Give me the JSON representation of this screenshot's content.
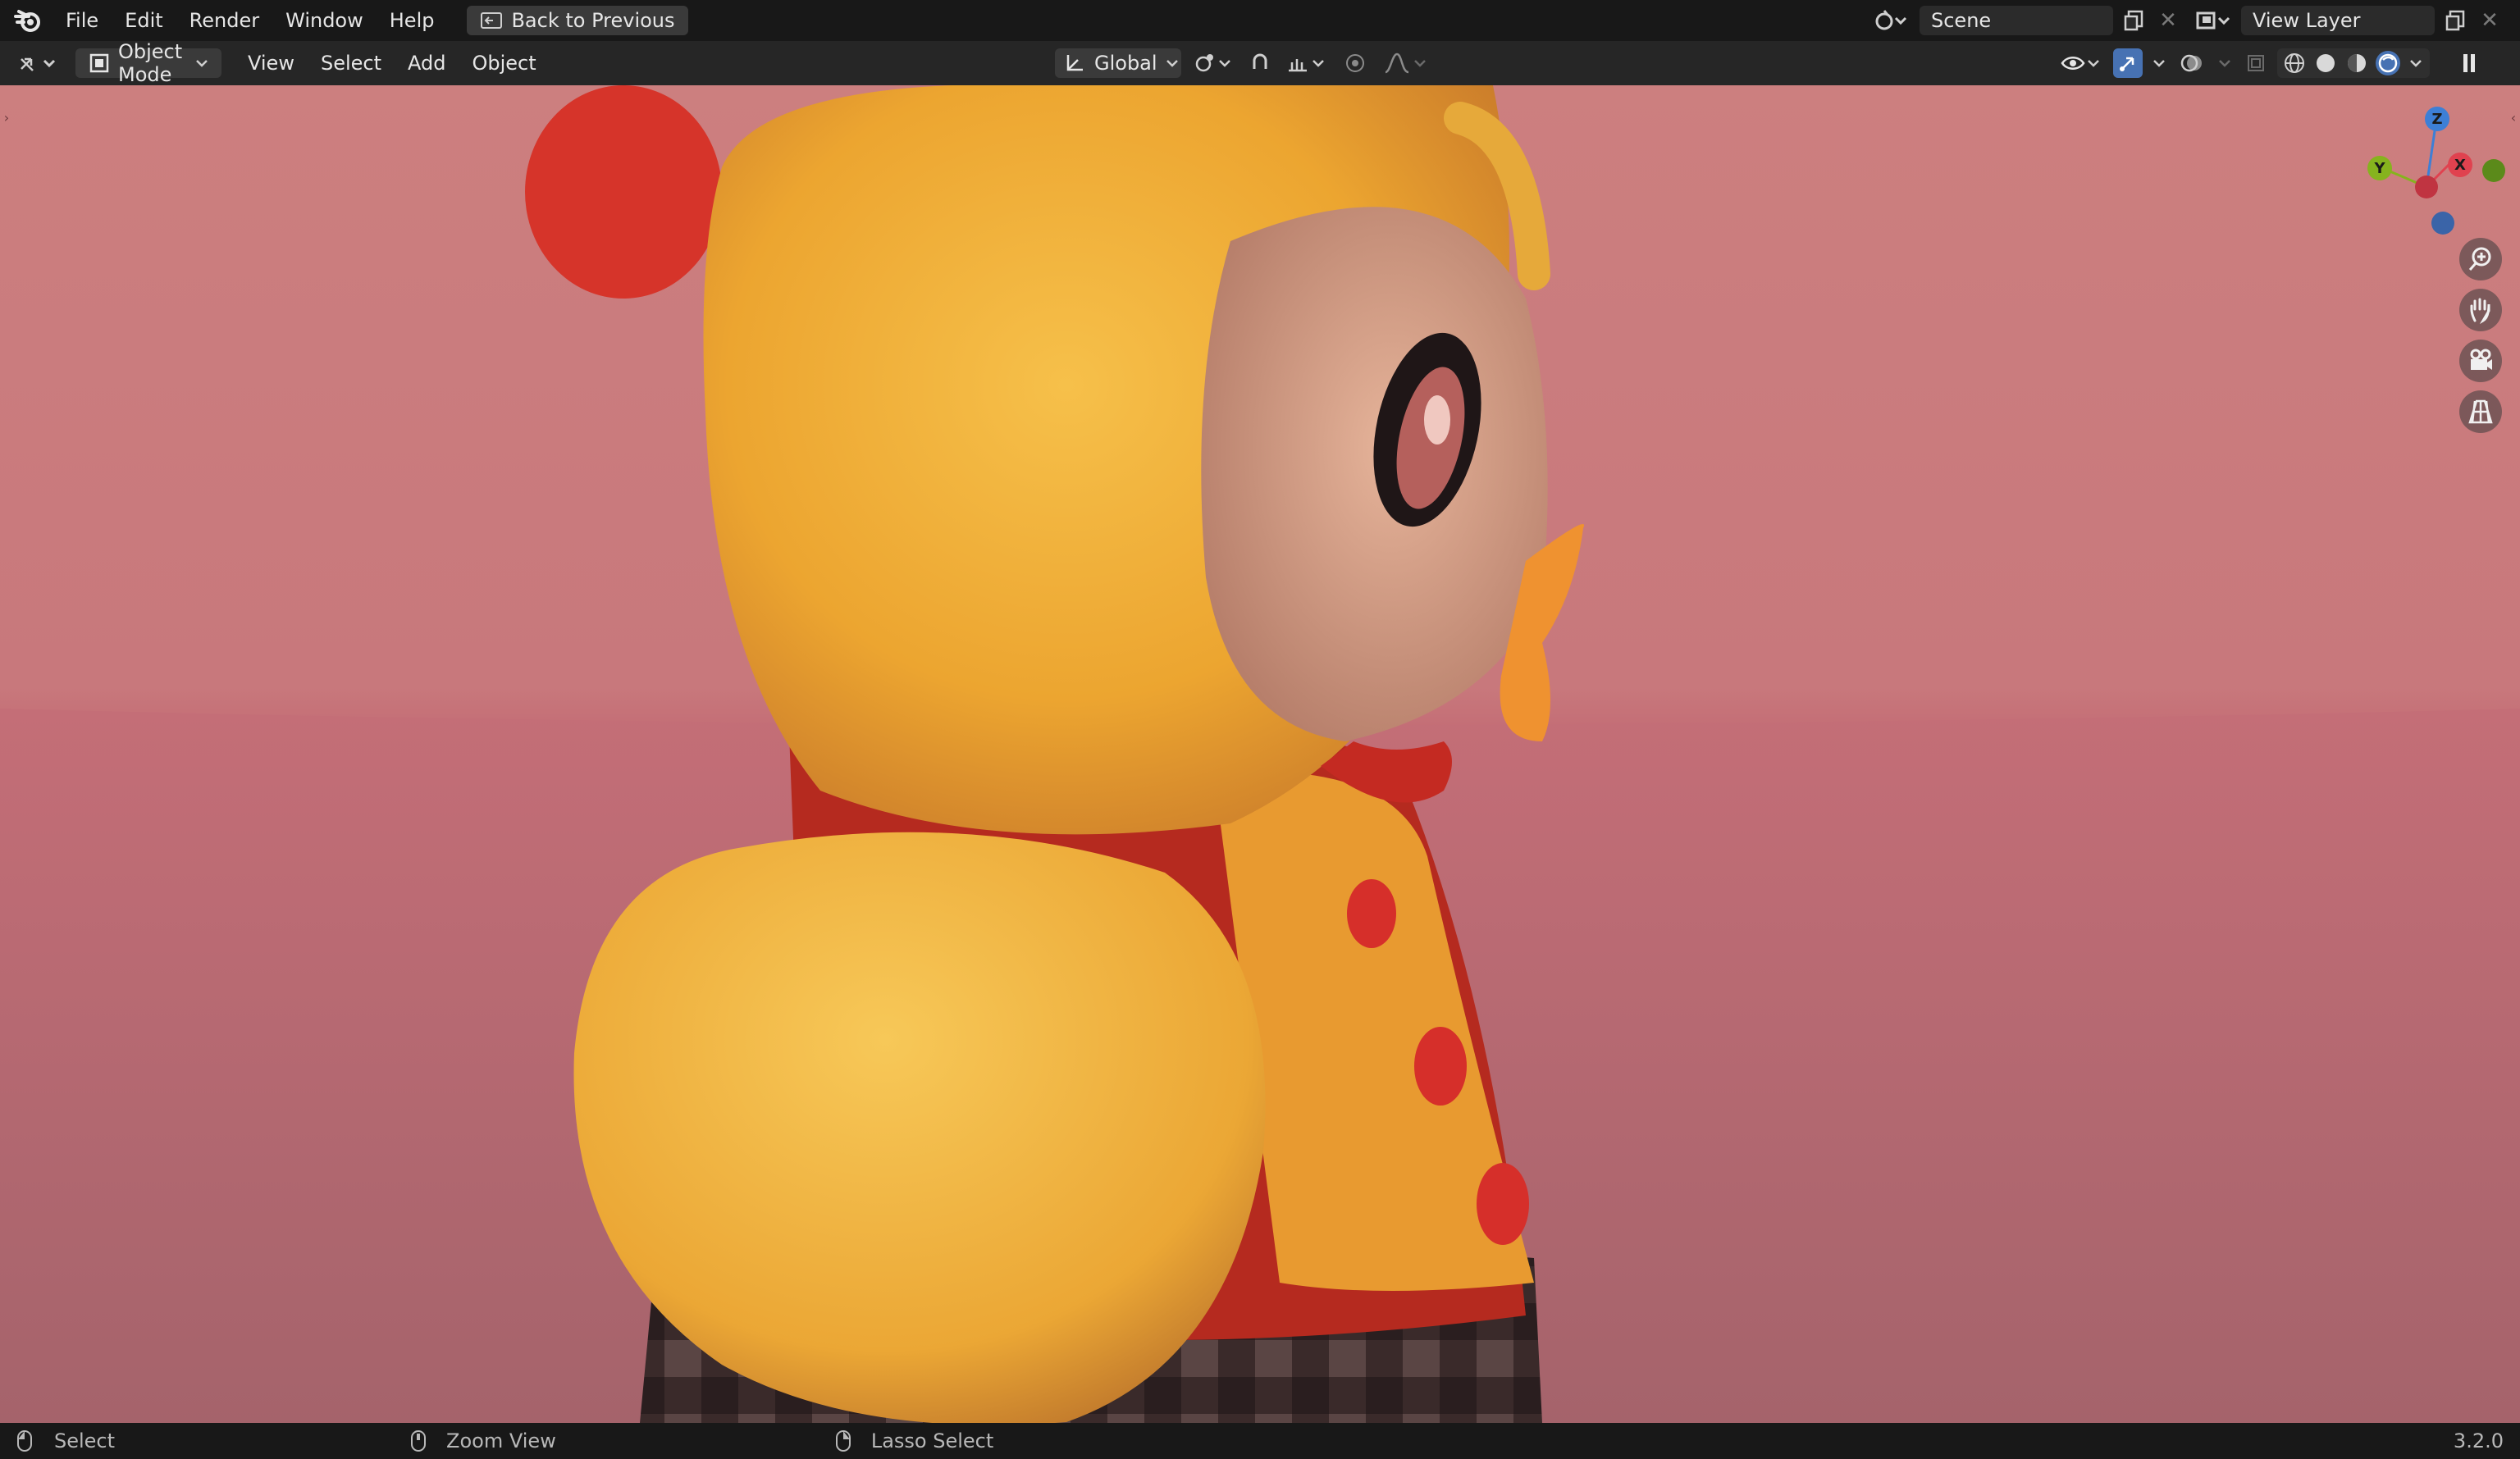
{
  "menu": {
    "file": "File",
    "edit": "Edit",
    "render": "Render",
    "window": "Window",
    "help": "Help",
    "back_button": "Back to Previous"
  },
  "scene": {
    "label": "Scene"
  },
  "view_layer": {
    "label": "View Layer"
  },
  "header": {
    "mode": "Object Mode",
    "view": "View",
    "select": "Select",
    "add": "Add",
    "object": "Object",
    "orientation": "Global"
  },
  "gizmo": {
    "z": "Z",
    "y": "Y",
    "x": "X"
  },
  "status": {
    "select": "Select",
    "zoom": "Zoom View",
    "lasso": "Lasso Select",
    "version": "3.2.0"
  },
  "colors": {
    "accent": "#4772b3",
    "axis_x": "#e0424f",
    "axis_y": "#86b31e",
    "axis_z": "#3d7fd6"
  }
}
